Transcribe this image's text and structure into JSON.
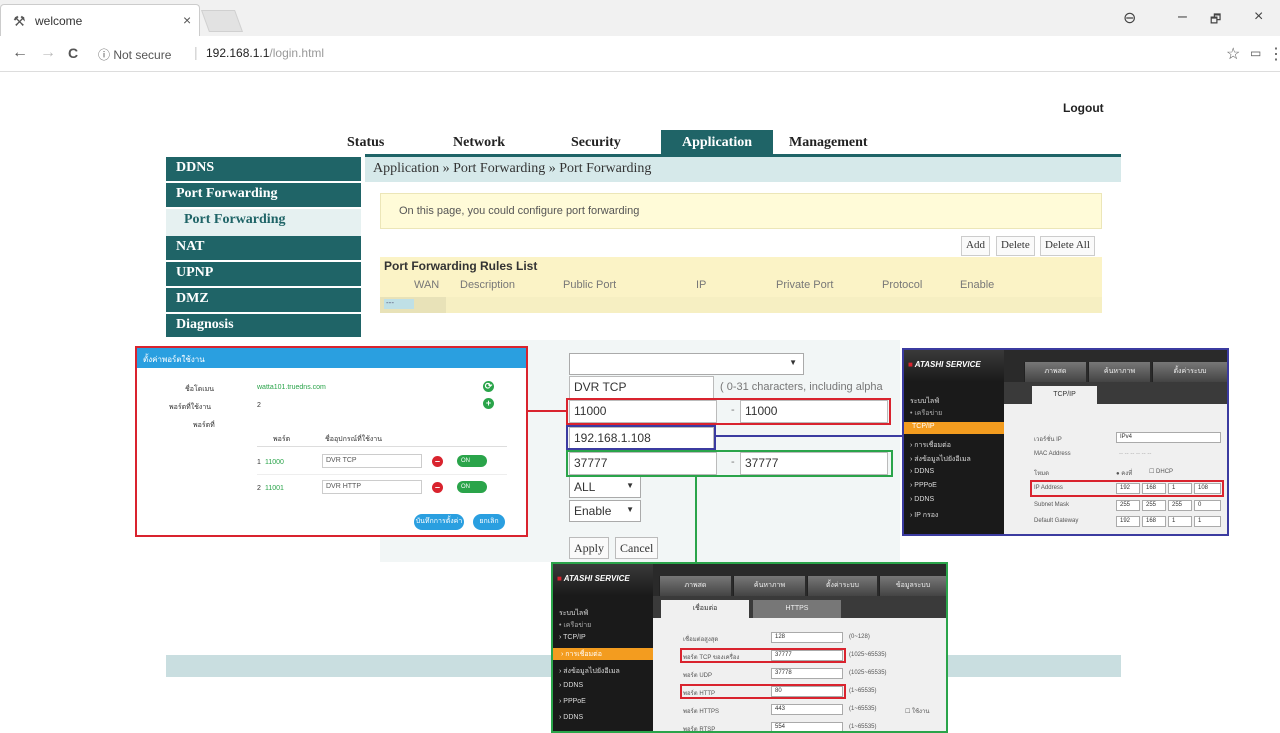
{
  "browser": {
    "tab_title": "welcome",
    "tab_close": "×",
    "security": "Not secure",
    "url_host": "192.168.1.1",
    "url_path": "/login.html",
    "back": "←",
    "forward": "→",
    "reload": "C",
    "star": "☆",
    "menu": "⋮",
    "profile": "⊖",
    "minimize": "–",
    "maximize": "🗗",
    "close": "×"
  },
  "header": {
    "logout": "Logout"
  },
  "topnav": [
    "Status",
    "Network",
    "Security",
    "Application",
    "Management"
  ],
  "breadcrumb": "Application » Port Forwarding » Port Forwarding",
  "sidebar": {
    "items": [
      "DDNS",
      "Port Forwarding",
      "NAT",
      "UPNP",
      "DMZ",
      "Diagnosis"
    ],
    "sub": "Port Forwarding"
  },
  "info_text": "On this page, you could configure port forwarding",
  "actions": {
    "add": "Add",
    "delete": "Delete",
    "delete_all": "Delete All"
  },
  "rules": {
    "title": "Port Forwarding Rules List",
    "columns": [
      "WAN",
      "Description",
      "Public Port",
      "IP",
      "Private Port",
      "Protocol",
      "Enable"
    ],
    "row_placeholder": "---"
  },
  "form": {
    "wan_select": "",
    "description": "DVR TCP",
    "description_hint": "( 0-31 characters, including alpha",
    "public_start": "11000",
    "public_end": "11000",
    "range_sep": "-",
    "ip": "192.168.1.108",
    "private_start": "37777",
    "private_end": "37777",
    "protocol": "ALL",
    "enable": "Enable",
    "apply": "Apply",
    "cancel": "Cancel",
    "dropdown_arrow": "▼"
  },
  "popup": {
    "title": "ตั้งค่าพอร์ตใช้งาน",
    "domain_label": "ชื่อโดเมน",
    "domain_value": "watta101.truedns.com",
    "device_label": "พอร์ตที่ใช้งาน",
    "device_value": "2",
    "port_label": "พอร์ตที่",
    "col_port": "พอร์ต",
    "col_desc": "ชื่ออุปกรณ์ที่ใช้งาน",
    "rows": [
      {
        "num": "1",
        "port": "11000",
        "desc": "DVR TCP",
        "toggle": "ON"
      },
      {
        "num": "2",
        "port": "11001",
        "desc": "DVR HTTP",
        "toggle": "ON"
      }
    ],
    "btn_save": "บันทึกการตั้งค่า",
    "btn_cancel": "ยกเลิก"
  },
  "dvr_net": {
    "brand": "ATASHI SERVICE",
    "tabs": [
      "ภาพสด",
      "ค้นหาภาพ",
      "ตั้งค่าระบบ"
    ],
    "side": [
      "ระบบไลฟ์",
      "• เครือข่าย",
      "TCP/IP",
      "› การเชื่อมต่อ",
      "› ส่งข้อมูลไปยังอีเมล",
      "› DDNS",
      "› PPPoE",
      "› DDNS",
      "› IP กรอง"
    ],
    "panel_tab": "TCP/IP",
    "labels": [
      "เวอร์ชั่น IP",
      "MAC Address",
      "โหมด",
      "IP Address",
      "Subnet Mask",
      "Default Gateway"
    ],
    "ip_version": "IPv4",
    "mac": "-- -- -- -- -- --",
    "mode_static": "คงที่",
    "mode_dhcp": "DHCP",
    "ip": [
      "192",
      "168",
      "1",
      "108"
    ],
    "mask": [
      "255",
      "255",
      "255",
      "0"
    ],
    "gateway": [
      "192",
      "168",
      "1",
      "1"
    ]
  },
  "dvr_conn": {
    "brand": "ATASHI SERVICE",
    "tabs": [
      "ภาพสด",
      "ค้นหาภาพ",
      "ตั้งค่าระบบ",
      "ข้อมูลระบบ"
    ],
    "side": [
      "ระบบไลฟ์",
      "• เครือข่าย",
      "› TCP/IP",
      "› การเชื่อมต่อ",
      "› ส่งข้อมูลไปยังอีเมล",
      "› DDNS",
      "› PPPoE",
      "› DDNS"
    ],
    "panel_tabs": [
      "เชื่อมต่อ",
      "HTTPS"
    ],
    "labels": [
      "เชื่อมต่อสูงสุด",
      "พอร์ต TCP ของเครื่อง",
      "พอร์ต UDP",
      "พอร์ต HTTP",
      "พอร์ต HTTPS",
      "พอร์ต RTSP"
    ],
    "values": [
      "128",
      "37777",
      "37778",
      "80",
      "443",
      "554"
    ],
    "ranges": [
      "(0~128)",
      "(1025~65535)",
      "(1025~65535)",
      "(1~65535)",
      "(1~65535)",
      "(1~65535)"
    ],
    "enable_label": "ใช้งาน"
  }
}
